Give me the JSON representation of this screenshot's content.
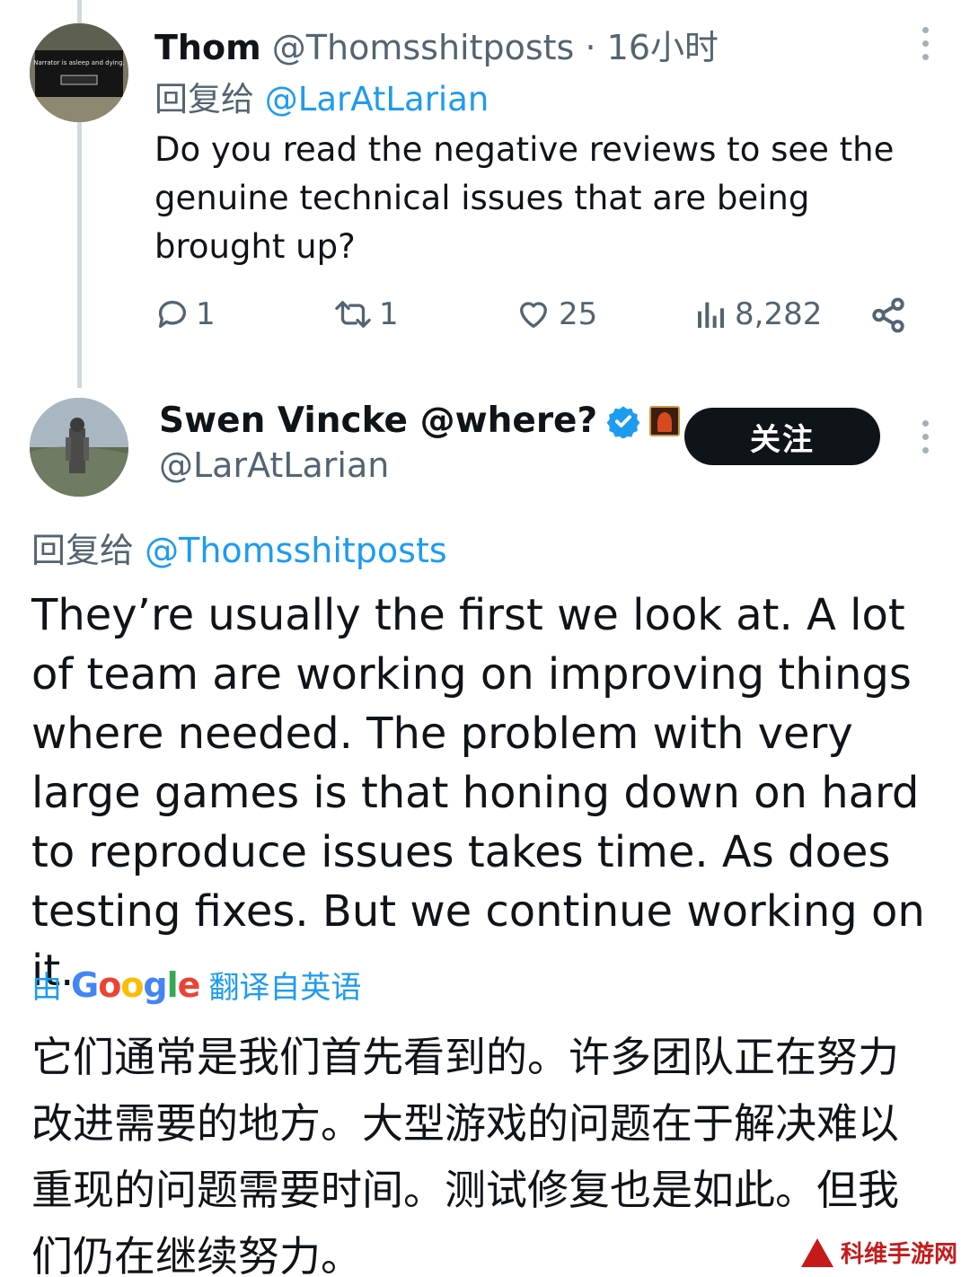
{
  "tweet1": {
    "display_name": "Thom",
    "handle": "@Thomsshitposts",
    "separator": "·",
    "time": "16小时",
    "reply_prefix": "回复给",
    "reply_to": "@LarAtLarian",
    "avatar_text": "Narrator is asleep and dying.",
    "text": "Do you read the negative reviews to see the genuine technical issues that are being brought up?",
    "stats": {
      "replies": "1",
      "retweets": "1",
      "likes": "25",
      "views": "8,282"
    }
  },
  "tweet2": {
    "display_name": "Swen Vincke @where?",
    "handle": "@LarAtLarian",
    "follow_label": "关注",
    "reply_prefix": "回复给",
    "reply_to": "@Thomsshitposts",
    "text": "They’re usually the first we look at. A lot of team are working on improving things where needed. The problem with very large games is that honing down on hard to reproduce issues takes time. As does testing fixes. But we continue working on it.",
    "translate_prefix": "由",
    "translate_brand": "Google",
    "translate_suffix": "翻译自英语",
    "translation": "它们通常是我们首先看到的。许多团队正在努力改进需要的地方。大型游戏的问题在于解决难以重现的问题需要时间。测试修复也是如此。但我们仍在继续努力。"
  },
  "watermark": "科维手游网",
  "colors": {
    "link": "#1d9bf0",
    "muted": "#536471",
    "text": "#0f1419",
    "watermark": "#c61a1a"
  },
  "icons": [
    "reply-icon",
    "retweet-icon",
    "like-icon",
    "views-icon",
    "share-icon",
    "verified-icon",
    "more-icon"
  ]
}
